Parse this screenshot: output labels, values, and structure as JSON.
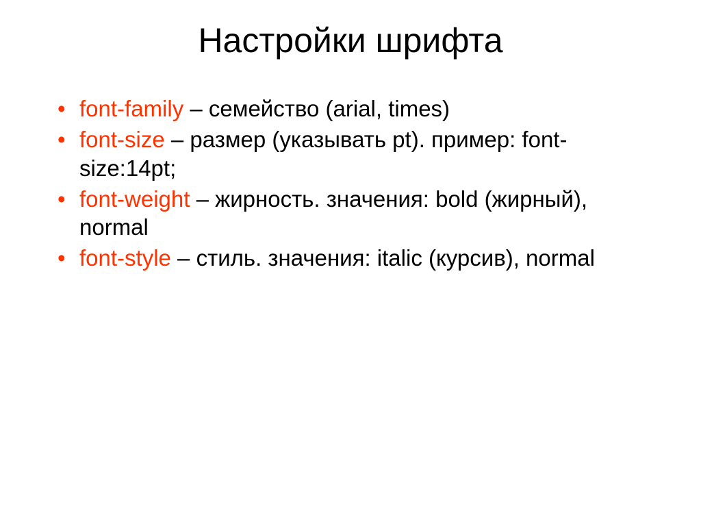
{
  "title": "Настройки шрифта",
  "items": [
    {
      "prop": "font-family",
      "desc": " – семейство (arial, times)"
    },
    {
      "prop": "font-size",
      "desc": " – размер (указывать pt). пример: font-size:14pt;"
    },
    {
      "prop": "font-weight",
      "desc": " – жирность. значения: bold (жирный), normal"
    },
    {
      "prop": "font-style",
      "desc": " – стиль. значения: italic (курсив), normal"
    }
  ]
}
